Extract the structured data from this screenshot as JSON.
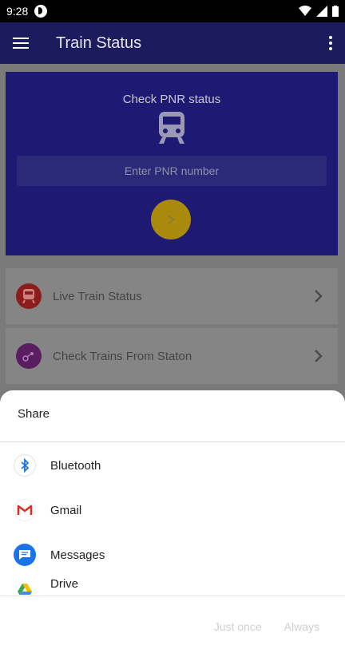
{
  "status_bar": {
    "time": "9:28"
  },
  "app_bar": {
    "title": "Train Status"
  },
  "pnr_card": {
    "title": "Check PNR status",
    "input_placeholder": "Enter PNR number"
  },
  "list": [
    {
      "label": "Live Train Status",
      "icon": "train-icon",
      "color": "#8d1d1d"
    },
    {
      "label": "Check Trains From Staton",
      "icon": "location-icon",
      "color": "#5a1d5f"
    }
  ],
  "share_sheet": {
    "title": "Share",
    "apps": [
      {
        "label": "Bluetooth",
        "icon": "bluetooth-icon"
      },
      {
        "label": "Gmail",
        "icon": "gmail-icon"
      },
      {
        "label": "Messages",
        "icon": "messages-icon"
      },
      {
        "label": "Drive",
        "icon": "drive-icon"
      }
    ],
    "actions": {
      "just_once": "Just once",
      "always": "Always"
    }
  },
  "colors": {
    "app_bar": "#1b1b5e",
    "pnr_card": "#1e1a74",
    "go_button": "#a98a0c",
    "bluetooth": "#1a73e8",
    "messages": "#1a73e8"
  }
}
